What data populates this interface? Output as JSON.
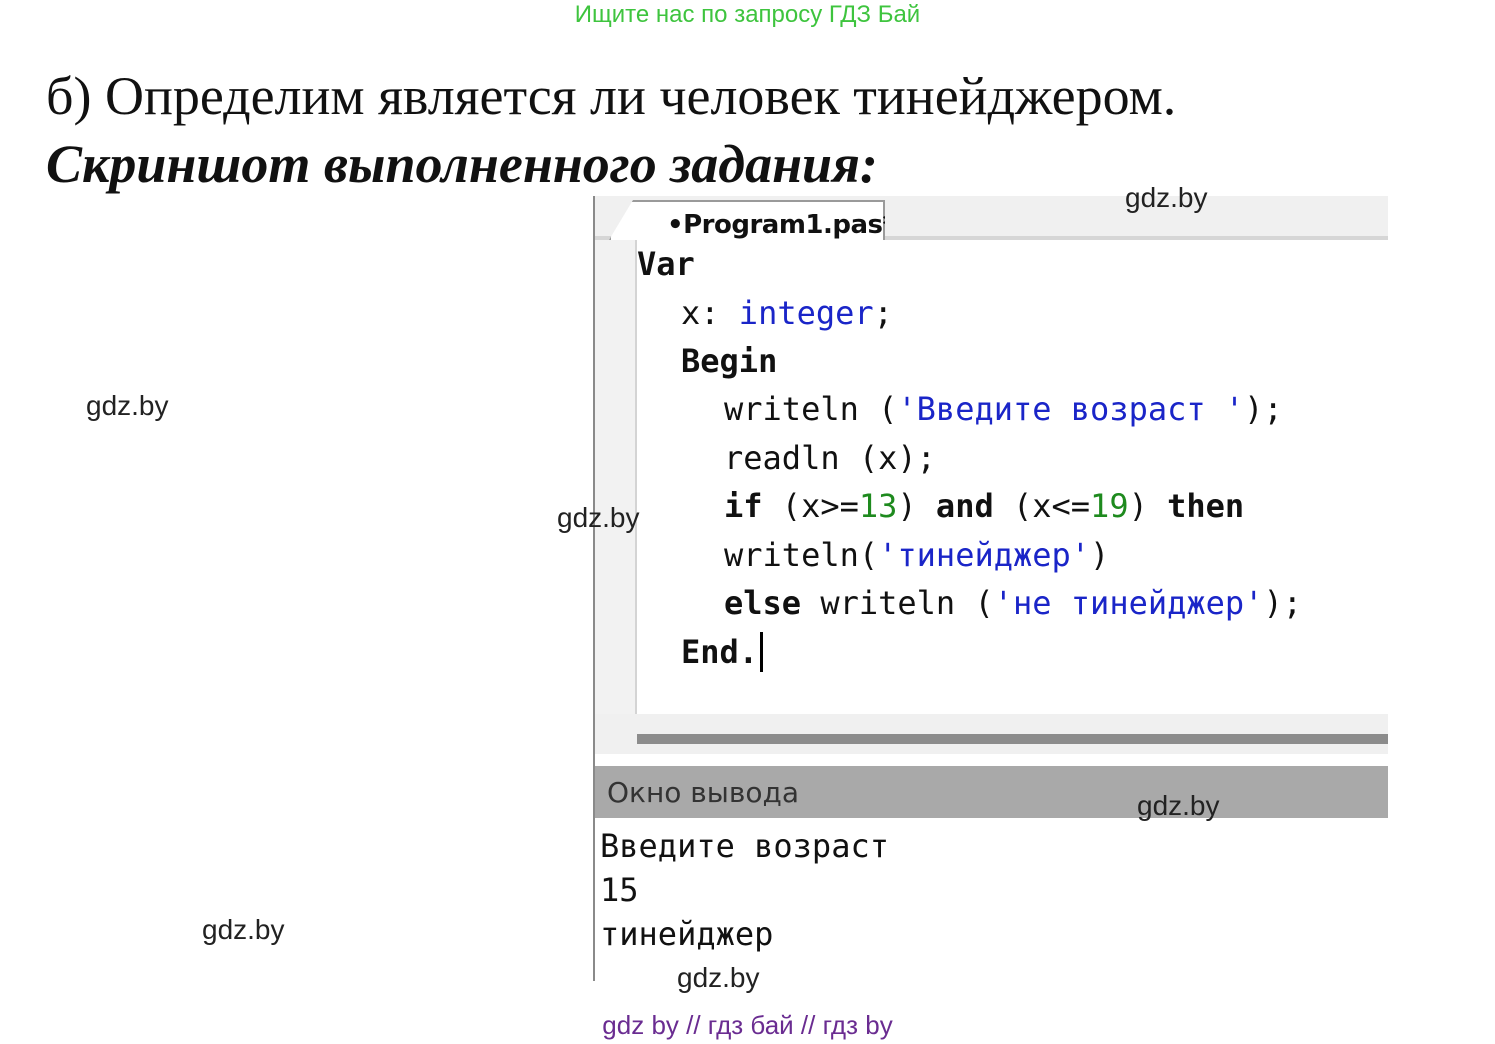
{
  "banner": "Ищите нас по запросу ГДЗ Бай",
  "heading": "б) Определим является ли человек тинейджером.",
  "subheading": "Скриншот выполненного задания:",
  "watermark": "gdz.by",
  "footer": "gdz by  //  гдз бай  //  гдз by",
  "ide": {
    "tab_label": "•Program1.pas*",
    "code": {
      "l1": {
        "kw": "Var"
      },
      "l2": {
        "a": "x: ",
        "type": "integer",
        "b": ";"
      },
      "l3": {
        "kw": "Begin"
      },
      "l4": {
        "a": "writeln (",
        "str": "'Введите возраст '",
        "b": ");"
      },
      "l5": {
        "a": "readln (x);"
      },
      "l6": {
        "kw1": "if",
        "a": " (x>=",
        "n1": "13",
        "b": ") ",
        "kw2": "and",
        "c": " (x<=",
        "n2": "19",
        "d": ") ",
        "kw3": "then"
      },
      "l7": {
        "a": "writeln(",
        "str": "'тинейджер'",
        "b": ")"
      },
      "l8": {
        "kw": "else",
        "a": " writeln (",
        "str": "'не тинейджер'",
        "b": ");"
      },
      "l9": {
        "kw": "End."
      }
    },
    "output_title": "Окно вывода",
    "output_lines": [
      "Введите возраст",
      "15",
      "тинейджер"
    ]
  },
  "colors": {
    "banner": "#3ec43e",
    "footer": "#6a2c91",
    "keyword_type_string": "#1a25c8",
    "number": "#1e8a1e",
    "output_header_bg": "#a9a9a9"
  }
}
